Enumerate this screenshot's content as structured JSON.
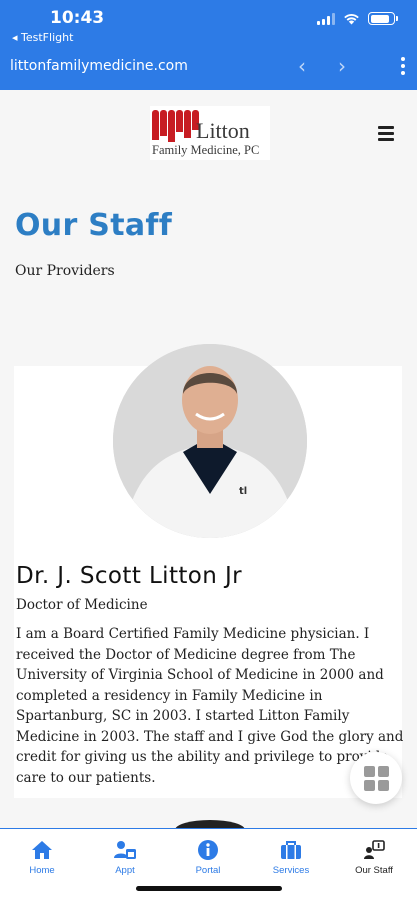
{
  "status_bar": {
    "time": "10:43",
    "back_app": "◂ TestFlight"
  },
  "browser": {
    "url": "littonfamilymedicine.com",
    "back_icon": "chevron-left-icon",
    "forward_icon": "chevron-right-icon",
    "menu_icon": "kebab-icon"
  },
  "logo": {
    "line1": "Litton",
    "line2": "Family Medicine, PC"
  },
  "page": {
    "title": "Our Staff",
    "subtitle": "Our Providers"
  },
  "provider": {
    "name": "Dr. J. Scott Litton Jr",
    "role": "Doctor of Medicine",
    "bio": "I am a Board Certified Family Medicine physician. I received the Doctor of Medicine degree from The University of Virginia School of Medicine in 2000 and completed a residency in Family Medicine in Spartanburg, SC in 2003.  I started Litton Family Medicine in 2003.  The staff and I  give God the glory and credit for giving us the ability and privilege to provide care to our patients."
  },
  "tabs": [
    {
      "label": "Home",
      "icon": "home-icon"
    },
    {
      "label": "Appt",
      "icon": "appointment-icon"
    },
    {
      "label": "Portal",
      "icon": "info-icon"
    },
    {
      "label": "Services",
      "icon": "briefcase-icon"
    },
    {
      "label": "Our Staff",
      "icon": "staff-icon"
    }
  ],
  "colors": {
    "brand_blue": "#2d7be6",
    "title_blue": "#2d7ec4",
    "logo_red": "#c71c22"
  }
}
